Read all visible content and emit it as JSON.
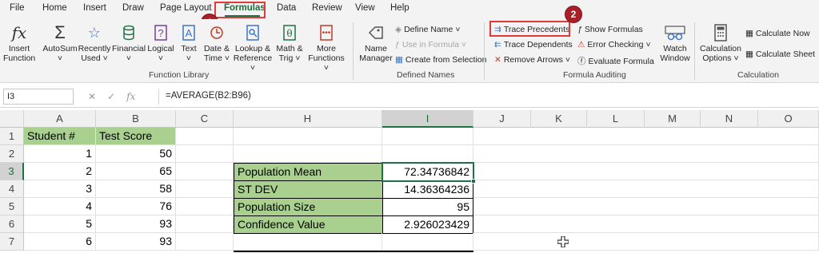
{
  "tabs": [
    "File",
    "Home",
    "Insert",
    "Draw",
    "Page Layout",
    "Formulas",
    "Data",
    "Review",
    "View",
    "Help"
  ],
  "active_tab": "Formulas",
  "badges": {
    "one": "1",
    "two": "2"
  },
  "ribbon": {
    "function_library": {
      "insert_function": [
        "Insert",
        "Function"
      ],
      "autosum": "AutoSum",
      "recently_used": [
        "Recently",
        "Used"
      ],
      "financial": "Financial",
      "logical": "Logical",
      "text": "Text",
      "date_time": [
        "Date &",
        "Time"
      ],
      "lookup_reference": [
        "Lookup &",
        "Reference"
      ],
      "math_trig": [
        "Math &",
        "Trig"
      ],
      "more_functions": [
        "More",
        "Functions"
      ],
      "label": "Function Library"
    },
    "defined_names": {
      "name_manager": [
        "Name",
        "Manager"
      ],
      "define_name": "Define Name",
      "use_in_formula": "Use in Formula",
      "create_from_selection": "Create from Selection",
      "label": "Defined Names"
    },
    "formula_auditing": {
      "trace_precedents": "Trace Precedents",
      "trace_dependents": "Trace Dependents",
      "remove_arrows": "Remove Arrows",
      "show_formulas": "Show Formulas",
      "error_checking": "Error Checking",
      "evaluate_formula": "Evaluate Formula",
      "watch_window": [
        "Watch",
        "Window"
      ],
      "label": "Formula Auditing"
    },
    "calculation": {
      "calculation_options": [
        "Calculation",
        "Options"
      ],
      "calculate_now": "Calculate Now",
      "calculate_sheet": "Calculate Sheet",
      "label": "Calculation"
    }
  },
  "formula_bar": {
    "name_box": "I3",
    "formula": "=AVERAGE(B2:B96)"
  },
  "columns": [
    "A",
    "B",
    "C",
    "H",
    "I",
    "J",
    "K",
    "L",
    "M",
    "N",
    "O"
  ],
  "rows": [
    "1",
    "2",
    "3",
    "4",
    "5",
    "6",
    "7"
  ],
  "cells": {
    "A1": "Student #",
    "B1": "Test Score",
    "A2": "1",
    "B2": "50",
    "A3": "2",
    "B3": "65",
    "A4": "3",
    "B4": "58",
    "A5": "4",
    "B5": "76",
    "A6": "5",
    "B6": "93",
    "A7": "6",
    "B7": "93",
    "H3": "Population Mean",
    "I3": "72.34736842",
    "H4": "ST DEV",
    "I4": "14.36364236",
    "H5": "Population Size",
    "I5": "95",
    "H6": "Confidence Value",
    "I6": "2.926023429"
  },
  "colors": {
    "accent_green": "#1e7145",
    "cell_green": "#a9d08e",
    "highlight_red": "#e03a3a",
    "badge": "#a8202a"
  }
}
